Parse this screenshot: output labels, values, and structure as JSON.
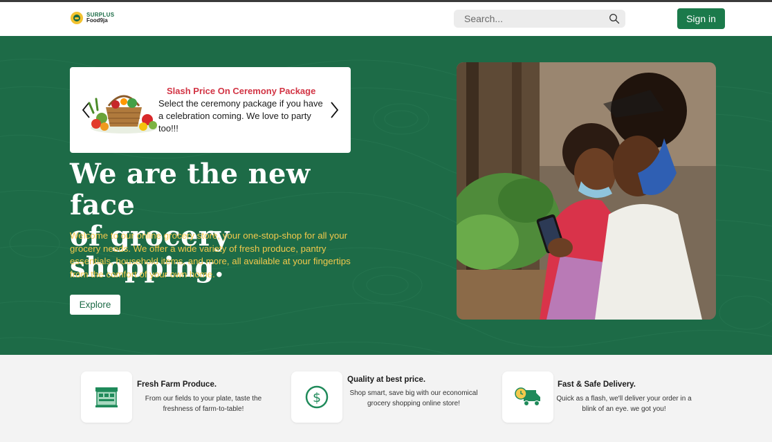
{
  "brand": {
    "line1": "SURPLUS",
    "line2": "Food9ja"
  },
  "search": {
    "placeholder": "Search..."
  },
  "header": {
    "signin_label": "Sign in"
  },
  "promo": {
    "title": "Slash Price On Ceremony Package",
    "text": "Select the ceremony package if you have a celebration coming. We love to party too!!!"
  },
  "hero": {
    "headline_line1": "We are the new face",
    "headline_line2": "of grocery shopping.",
    "intro": "Welcome to our online grocery store, your one-stop-shop for all your grocery needs. We offer a wide variety of fresh produce, pantry essentials, household items, and more, all available at your fingertips from the comfort of your own home.",
    "explore_label": "Explore"
  },
  "features": [
    {
      "icon": "market-stall-icon",
      "title": "Fresh Farm Produce.",
      "desc": "From our fields to your plate, taste the freshness of farm-to-table!"
    },
    {
      "icon": "dollar-icon",
      "title": "Quality at best price.",
      "desc": "Shop smart, save big with our economical grocery shopping online store!"
    },
    {
      "icon": "delivery-truck-icon",
      "title": "Fast & Safe Delivery.",
      "desc": "Quick as a flash, we'll deliver your order in a blink of an eye. we got you!"
    }
  ],
  "colors": {
    "brand_green": "#1d6b47",
    "button_green": "#1b7a4b",
    "accent_yellow": "#f2c94c",
    "promo_red": "#d23444"
  }
}
